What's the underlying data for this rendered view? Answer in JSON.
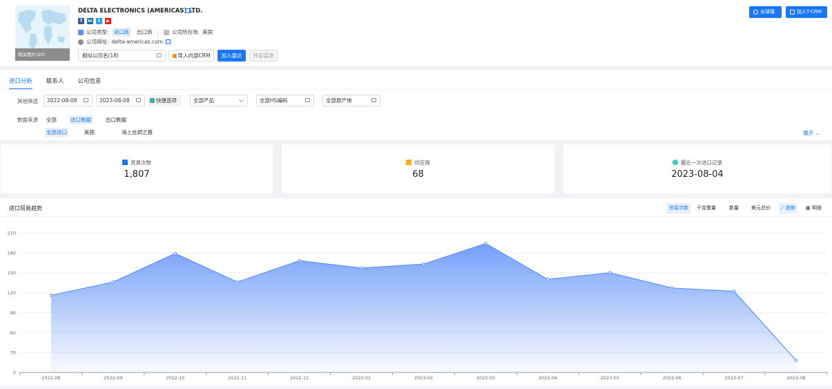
{
  "header": {
    "company_name": "DELTA ELECTRONICS (AMERICAS) LTD.",
    "map_caption": "相关图片(20)",
    "type_label": "公司类型:",
    "type_importer": "进口商",
    "type_exporter": "出口商",
    "location_label": "公司所在地:",
    "location_value": "美国",
    "website_label": "公司网址:",
    "website_value": "delta-americas.com",
    "similar_companies": "相似公司名(18)",
    "btn_import_crm": "导入内部CRM",
    "btn_add_radar": "加入雷达",
    "btn_monitor": "开启监测",
    "btn_global_search": "全球搜",
    "btn_add_tcrm": "加入T-CRM",
    "socials": [
      {
        "name": "facebook",
        "glyph": "f",
        "color": "#3b5998"
      },
      {
        "name": "linkedin",
        "glyph": "in",
        "color": "#0e76a8"
      },
      {
        "name": "twitter",
        "glyph": "t",
        "color": "#1da1f2"
      },
      {
        "name": "youtube",
        "glyph": "▶",
        "color": "#e62117"
      }
    ]
  },
  "tabs": [
    "进口分析",
    "联系人",
    "公司信息"
  ],
  "filters": {
    "other_label": "其他筛选",
    "date_start": "2022-08-08",
    "date_end": "2023-08-08",
    "quick_options": "快捷选项",
    "product": "全部产品",
    "hs_code": "全部HS编码",
    "origin": "全部原产地",
    "source_label": "数据来源",
    "source_all": "全部",
    "source_import": "进口数据",
    "source_export": "出口数据",
    "sub_all_import": "全部进口",
    "sub_usa": "美国",
    "sub_silk_road": "海上丝绸之路",
    "expand": "展开"
  },
  "stats": [
    {
      "label": "贸易次数",
      "value": "1,807",
      "icon_color": "#1677ff"
    },
    {
      "label": "供应商",
      "value": "68",
      "icon_color": "#faad14"
    },
    {
      "label": "最近一次进口记录",
      "value": "2023-08-04",
      "icon_color": "#36cfc9"
    }
  ],
  "chart_section": {
    "title": "进口贸易趋势",
    "metric_tabs": [
      "贸易次数",
      "千克重量",
      "数量",
      "美元总价"
    ],
    "view_tabs": [
      "趋势",
      "明细"
    ]
  },
  "chart_data": {
    "type": "area",
    "categories": [
      "2022-08",
      "2022-09",
      "2022-10",
      "2022-11",
      "2022-12",
      "2023-01",
      "2023-02",
      "2023-03",
      "2023-04",
      "2023-05",
      "2023-06",
      "2023-07",
      "2023-08"
    ],
    "values": [
      116,
      136,
      179,
      136,
      168,
      157,
      163,
      194,
      140,
      150,
      127,
      122,
      18
    ],
    "y_ticks": [
      0,
      30,
      60,
      90,
      120,
      150,
      180,
      210
    ],
    "ylim": [
      0,
      210
    ],
    "grid": true,
    "line_color": "#5b8ff9"
  }
}
